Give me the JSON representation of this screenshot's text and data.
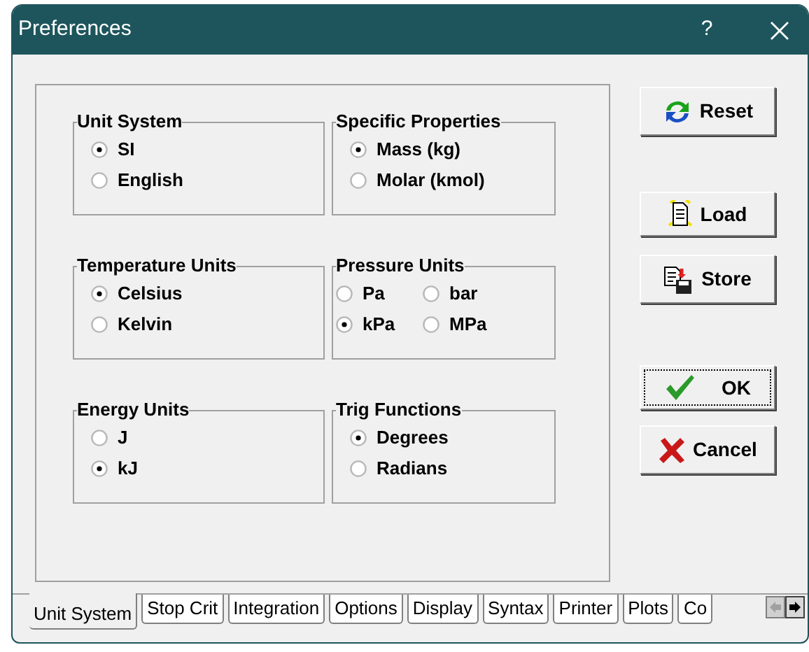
{
  "window": {
    "title": "Preferences",
    "help": "?"
  },
  "groups": [
    {
      "title": "Unit System",
      "kind": "column",
      "options": [
        {
          "label": "SI",
          "selected": true
        },
        {
          "label": "English",
          "selected": false
        }
      ]
    },
    {
      "title": "Specific Properties",
      "kind": "column",
      "options": [
        {
          "label": "Mass (kg)",
          "selected": true
        },
        {
          "label": "Molar (kmol)",
          "selected": false
        }
      ]
    },
    {
      "title": "Temperature Units",
      "kind": "column",
      "options": [
        {
          "label": "Celsius",
          "selected": true
        },
        {
          "label": "Kelvin",
          "selected": false
        }
      ]
    },
    {
      "title": "Pressure Units",
      "kind": "grid",
      "options": [
        {
          "label": "Pa",
          "selected": false
        },
        {
          "label": "bar",
          "selected": false
        },
        {
          "label": "kPa",
          "selected": true
        },
        {
          "label": "MPa",
          "selected": false
        }
      ]
    },
    {
      "title": "Energy Units",
      "kind": "column",
      "options": [
        {
          "label": "J",
          "selected": false
        },
        {
          "label": "kJ",
          "selected": true
        }
      ]
    },
    {
      "title": "Trig Functions",
      "kind": "column",
      "options": [
        {
          "label": "Degrees",
          "selected": true
        },
        {
          "label": "Radians",
          "selected": false
        }
      ]
    }
  ],
  "buttons": [
    {
      "label": "Reset",
      "kind": "reset",
      "default": false
    },
    {
      "label": "Load",
      "kind": "load",
      "default": false
    },
    {
      "label": "Store",
      "kind": "store",
      "default": false
    },
    {
      "label": "OK",
      "kind": "ok",
      "default": true
    },
    {
      "label": "Cancel",
      "kind": "cancel",
      "default": false
    }
  ],
  "tabs": [
    {
      "label": "Unit System",
      "selected": true
    },
    {
      "label": "Stop Crit",
      "selected": false
    },
    {
      "label": "Integration",
      "selected": false
    },
    {
      "label": "Options",
      "selected": false
    },
    {
      "label": "Display",
      "selected": false
    },
    {
      "label": "Syntax",
      "selected": false
    },
    {
      "label": "Printer",
      "selected": false
    },
    {
      "label": "Plots",
      "selected": false
    },
    {
      "label": "Co",
      "selected": false
    }
  ]
}
